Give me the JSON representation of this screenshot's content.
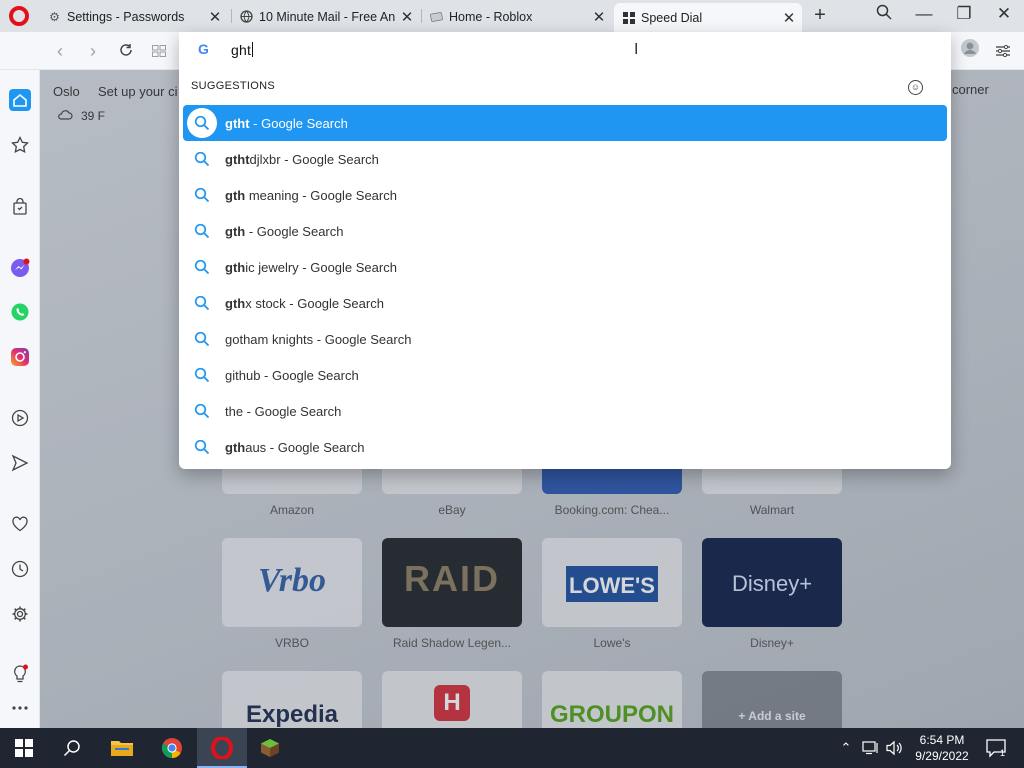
{
  "browser": {
    "tabs": [
      {
        "title": "Settings - Passwords",
        "icon": "gear-icon",
        "active": false
      },
      {
        "title": "10 Minute Mail - Free An",
        "icon": "globe-icon",
        "active": false
      },
      {
        "title": "Home - Roblox",
        "icon": "roblox-icon",
        "active": false
      },
      {
        "title": "Speed Dial",
        "icon": "speed-dial-icon",
        "active": true
      }
    ],
    "new_tab": "+",
    "window_controls": {
      "minimize": "—",
      "restore": "❐",
      "close": "✕"
    }
  },
  "address_bar": {
    "query": "ght",
    "search_engine_icon": "G"
  },
  "suggestions": {
    "header": "SUGGESTIONS",
    "items": [
      {
        "bold": "gtht",
        "rest": " - Google Search",
        "selected": true
      },
      {
        "bold": "gtht",
        "rest": "djlxbr - Google Search"
      },
      {
        "bold": "gth",
        "rest": " meaning - Google Search"
      },
      {
        "bold": "gth",
        "rest": " - Google Search"
      },
      {
        "bold": "gth",
        "rest": "ic jewelry - Google Search"
      },
      {
        "bold": "gth",
        "rest": "x stock - Google Search"
      },
      {
        "bold": "",
        "rest": "gotham knights - Google Search"
      },
      {
        "bold": "",
        "rest": "github - Google Search"
      },
      {
        "bold": "",
        "rest": "the - Google Search"
      },
      {
        "bold": "gth",
        "rest": "aus - Google Search"
      }
    ]
  },
  "page": {
    "weather_city": "Oslo",
    "weather_temp": "39 F",
    "setup_text": "Set up your ci",
    "corner_text": "corner",
    "speed_dial": [
      {
        "label": "Amazon",
        "logo": ""
      },
      {
        "label": "eBay",
        "logo": ""
      },
      {
        "label": "Booking.com: Chea...",
        "logo": ""
      },
      {
        "label": "Walmart",
        "logo": ""
      },
      {
        "label": "VRBO",
        "logo": "Vrbo"
      },
      {
        "label": "Raid Shadow Legen...",
        "logo": "RAID"
      },
      {
        "label": "Lowe's",
        "logo": "LOWE'S"
      },
      {
        "label": "Disney+",
        "logo": "Disney+"
      },
      {
        "label": "",
        "logo": "Expedia"
      },
      {
        "label": "",
        "logo": "H"
      },
      {
        "label": "",
        "logo": "GROUPON"
      },
      {
        "label": "",
        "logo": "+ Add a site"
      }
    ]
  },
  "taskbar": {
    "time": "6:54 PM",
    "date": "9/29/2022",
    "notification_count": "1"
  },
  "colors": {
    "accent": "#1e96f2",
    "opera_red": "#e3101c",
    "taskbar": "#1f2631"
  }
}
